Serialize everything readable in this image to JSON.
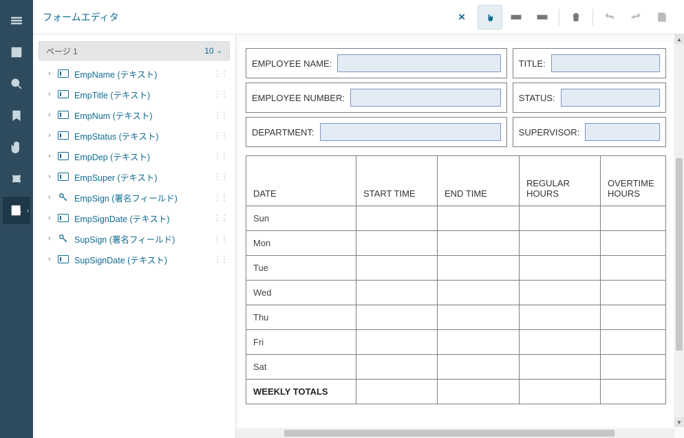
{
  "header": {
    "title": "フォームエディタ"
  },
  "panel": {
    "page_label": "ページ 1",
    "page_count": "10",
    "fields": [
      {
        "name": "EmpName",
        "type_label": "(テキスト)",
        "kind": "text"
      },
      {
        "name": "EmpTitle",
        "type_label": "(テキスト)",
        "kind": "text"
      },
      {
        "name": "EmpNum",
        "type_label": "(テキスト)",
        "kind": "text"
      },
      {
        "name": "EmpStatus",
        "type_label": "(テキスト)",
        "kind": "text"
      },
      {
        "name": "EmpDep",
        "type_label": "(テキスト)",
        "kind": "text"
      },
      {
        "name": "EmpSuper",
        "type_label": "(テキスト)",
        "kind": "text"
      },
      {
        "name": "EmpSign",
        "type_label": "(署名フィールド)",
        "kind": "sign"
      },
      {
        "name": "EmpSignDate",
        "type_label": "(テキスト)",
        "kind": "text"
      },
      {
        "name": "SupSign",
        "type_label": "(署名フィールド)",
        "kind": "sign"
      },
      {
        "name": "SupSignDate",
        "type_label": "(テキスト)",
        "kind": "text"
      }
    ]
  },
  "form": {
    "left": [
      {
        "label": "EMPLOYEE NAME:"
      },
      {
        "label": "EMPLOYEE NUMBER:"
      },
      {
        "label": "DEPARTMENT:"
      }
    ],
    "right": [
      {
        "label": "TITLE:"
      },
      {
        "label": "STATUS:"
      },
      {
        "label": "SUPERVISOR:"
      }
    ],
    "table": {
      "headers": [
        "DATE",
        "START TIME",
        "END TIME",
        "REGULAR HOURS",
        "OVERTIME HOURS"
      ],
      "rows": [
        "Sun",
        "Mon",
        "Tue",
        "Wed",
        "Thu",
        "Fri",
        "Sat"
      ],
      "footer": "WEEKLY TOTALS"
    }
  }
}
